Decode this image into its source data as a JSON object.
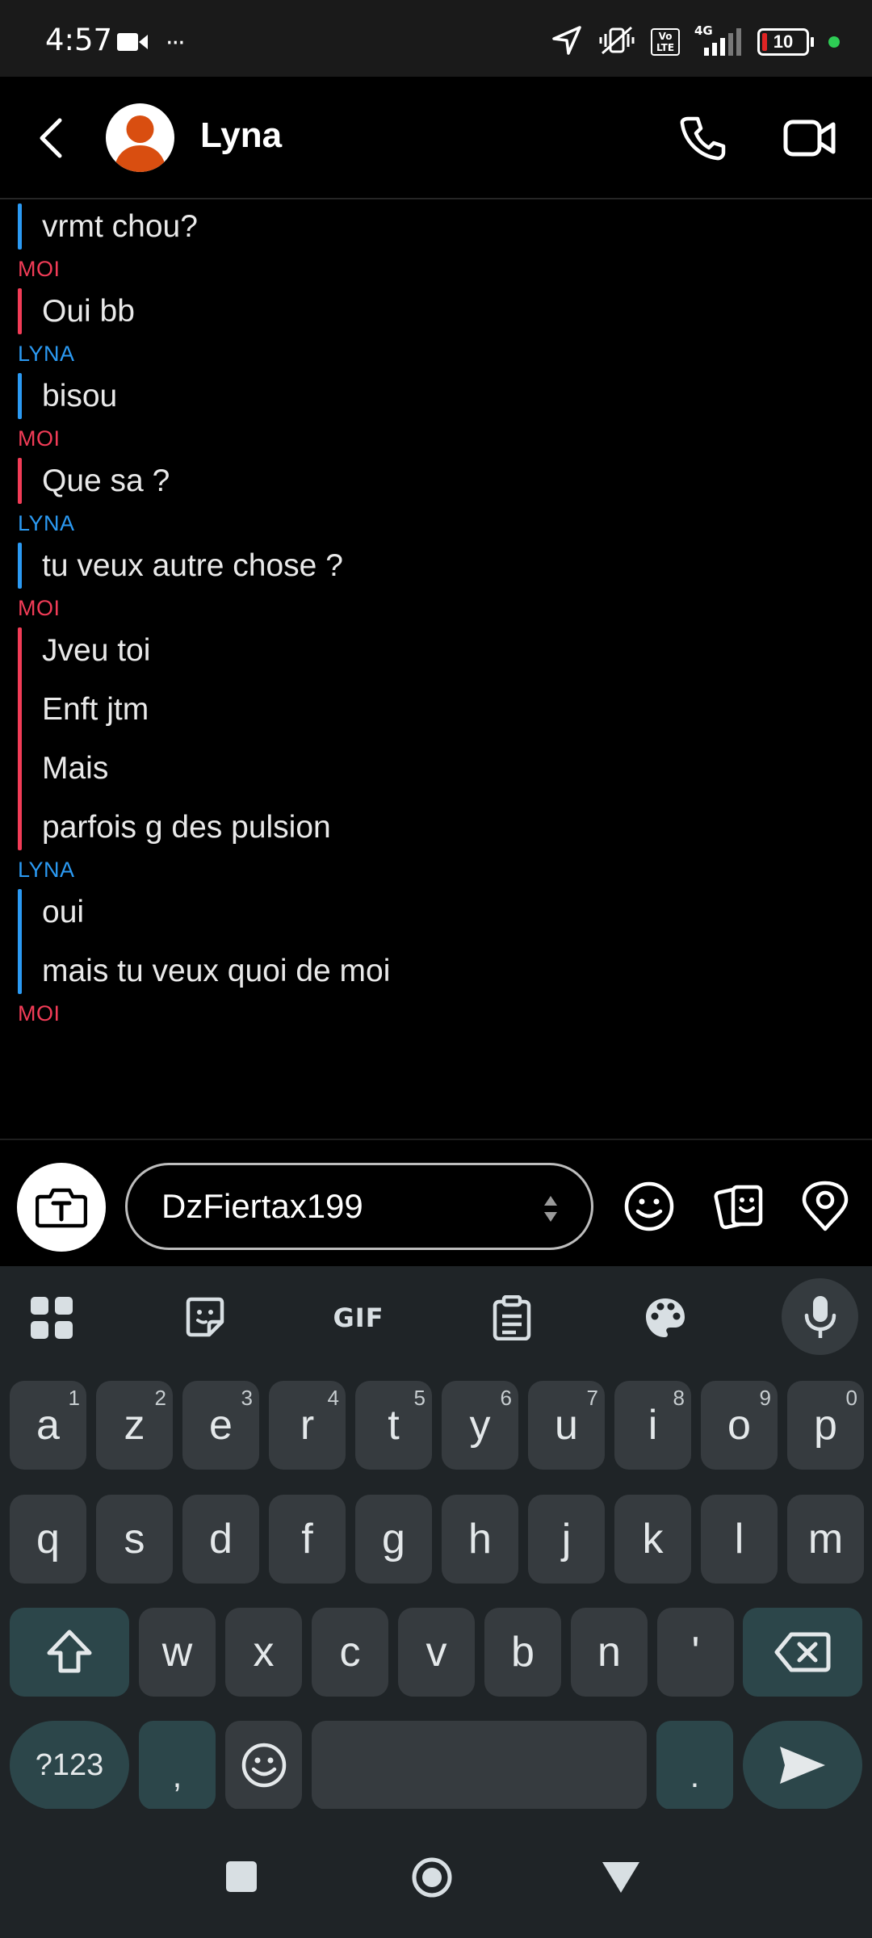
{
  "status_bar": {
    "time": "4:57",
    "more": "···",
    "battery": "10",
    "network": "4G",
    "volte": "Vo LTE"
  },
  "header": {
    "contact_name": "Lyna"
  },
  "conversation": [
    {
      "sender_key": "lyna",
      "sender": "",
      "messages": [
        "vrmt chou?"
      ]
    },
    {
      "sender_key": "moi",
      "sender": "MOI",
      "messages": [
        "Oui bb"
      ]
    },
    {
      "sender_key": "lyna",
      "sender": "LYNA",
      "messages": [
        "bisou"
      ]
    },
    {
      "sender_key": "moi",
      "sender": "MOI",
      "messages": [
        "Que sa ?"
      ]
    },
    {
      "sender_key": "lyna",
      "sender": "LYNA",
      "messages": [
        "tu veux autre chose ?"
      ]
    },
    {
      "sender_key": "moi",
      "sender": "MOI",
      "messages": [
        "Jveu toi",
        "Enft jtm",
        "Mais",
        "parfois g des pulsion"
      ]
    },
    {
      "sender_key": "lyna",
      "sender": "LYNA",
      "messages": [
        "oui",
        "mais tu veux quoi de moi"
      ]
    },
    {
      "sender_key": "moi",
      "sender": "MOI",
      "messages": []
    }
  ],
  "composer": {
    "input_value": "DzFiertax199"
  },
  "keyboard": {
    "toolbar": {
      "gif": "GIF"
    },
    "row1": [
      {
        "k": "a",
        "h": "1"
      },
      {
        "k": "z",
        "h": "2"
      },
      {
        "k": "e",
        "h": "3"
      },
      {
        "k": "r",
        "h": "4"
      },
      {
        "k": "t",
        "h": "5"
      },
      {
        "k": "y",
        "h": "6"
      },
      {
        "k": "u",
        "h": "7"
      },
      {
        "k": "i",
        "h": "8"
      },
      {
        "k": "o",
        "h": "9"
      },
      {
        "k": "p",
        "h": "0"
      }
    ],
    "row2": [
      "q",
      "s",
      "d",
      "f",
      "g",
      "h",
      "j",
      "k",
      "l",
      "m"
    ],
    "row3": [
      "w",
      "x",
      "c",
      "v",
      "b",
      "n",
      "'"
    ],
    "row4": {
      "symbols": "?123",
      "comma": ",",
      "period": "."
    }
  },
  "colors": {
    "moi": "#f23c57",
    "lyna": "#2b9af3",
    "key": "#363b3f",
    "special_key": "#2c464a"
  }
}
